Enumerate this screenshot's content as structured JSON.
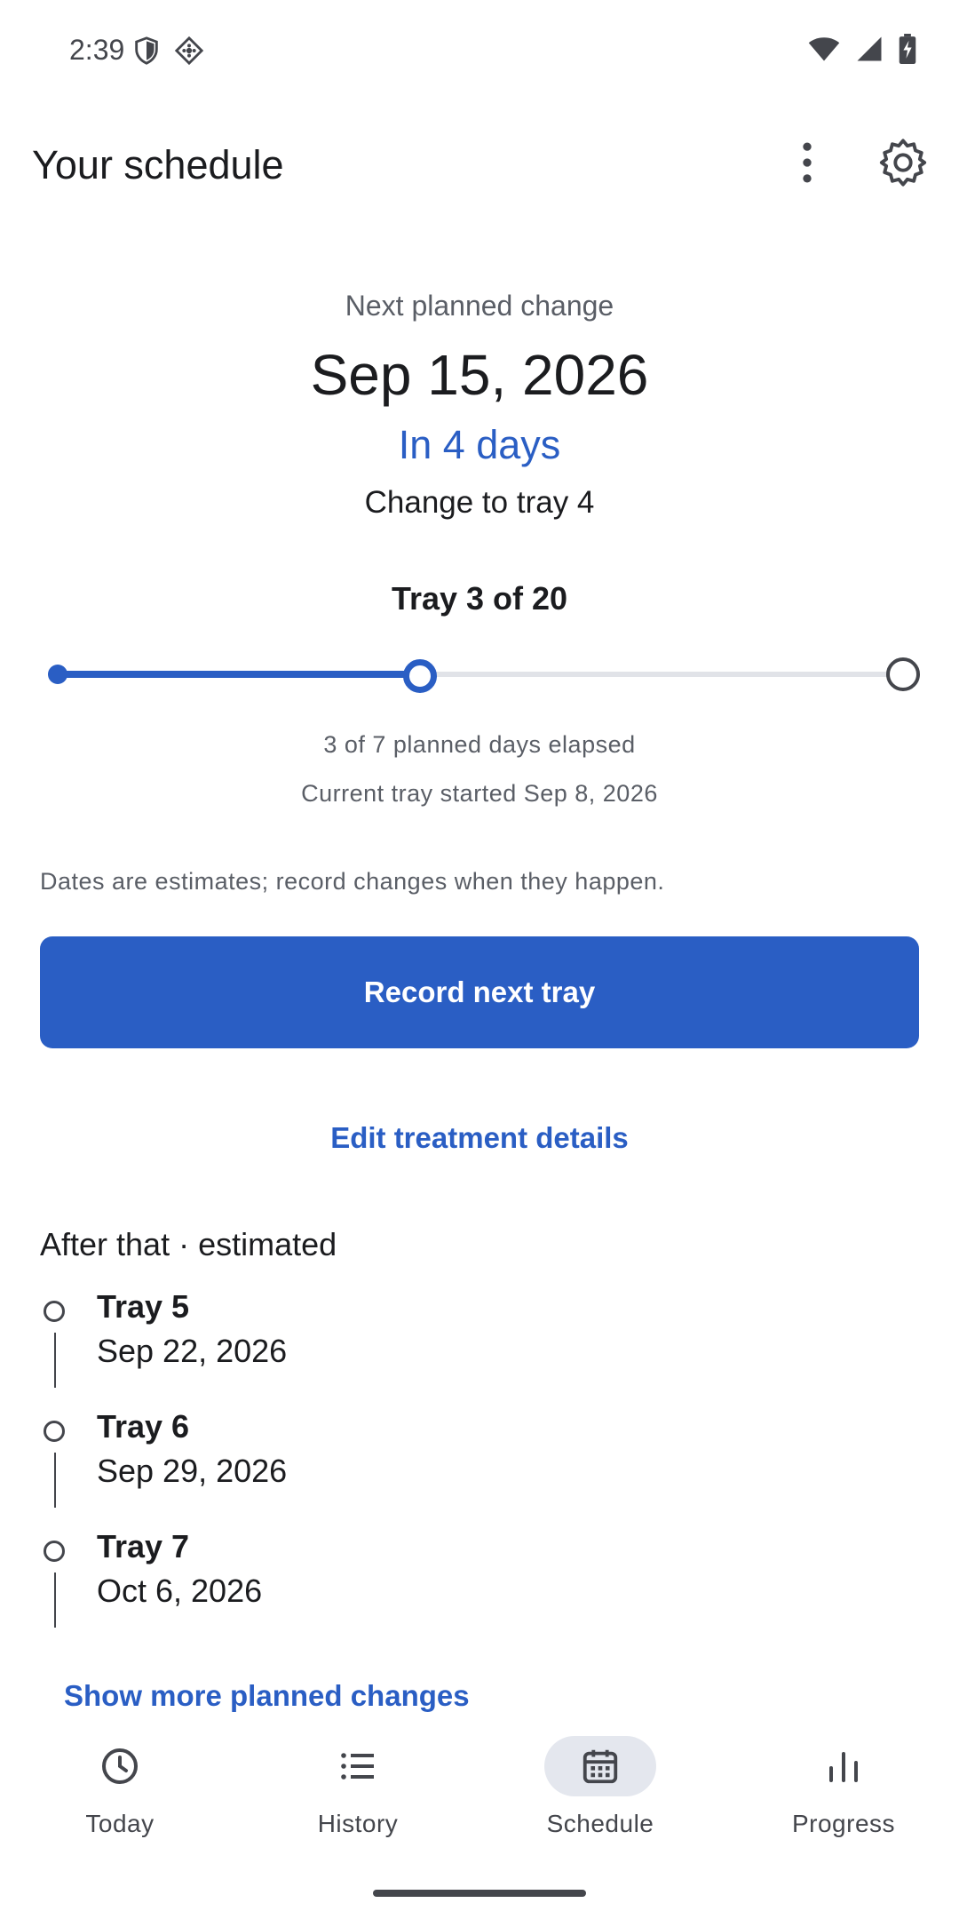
{
  "status_bar": {
    "time": "2:39"
  },
  "app_bar": {
    "title": "Your schedule"
  },
  "summary": {
    "next_label": "Next planned change",
    "next_date": "Sep 15, 2026",
    "countdown": "In 4 days",
    "change_to": "Change to tray 4",
    "tray_count": "Tray 3 of 20",
    "progress_fraction": 0.43,
    "elapsed_text": "3 of 7 planned days elapsed",
    "started_text": "Current tray started Sep 8, 2026",
    "disclaimer": "Dates are estimates; record changes when they happen."
  },
  "actions": {
    "record_label": "Record next tray",
    "edit_label": "Edit treatment details"
  },
  "upcoming": {
    "title": "After that · estimated",
    "items": [
      {
        "name": "Tray 5",
        "date": "Sep 22, 2026"
      },
      {
        "name": "Tray 6",
        "date": "Sep 29, 2026"
      },
      {
        "name": "Tray 7",
        "date": "Oct 6, 2026"
      }
    ],
    "show_more_label": "Show more planned changes"
  },
  "nav": {
    "items": [
      {
        "label": "Today",
        "icon": "clock-icon",
        "active": false
      },
      {
        "label": "History",
        "icon": "list-icon",
        "active": false
      },
      {
        "label": "Schedule",
        "icon": "calendar-icon",
        "active": true
      },
      {
        "label": "Progress",
        "icon": "bar-chart-icon",
        "active": false
      }
    ]
  },
  "colors": {
    "accent": "#2a5ec4",
    "text": "#1b1c1f",
    "muted": "#5a5e66",
    "nav_active_bg": "#e4e7ee"
  }
}
